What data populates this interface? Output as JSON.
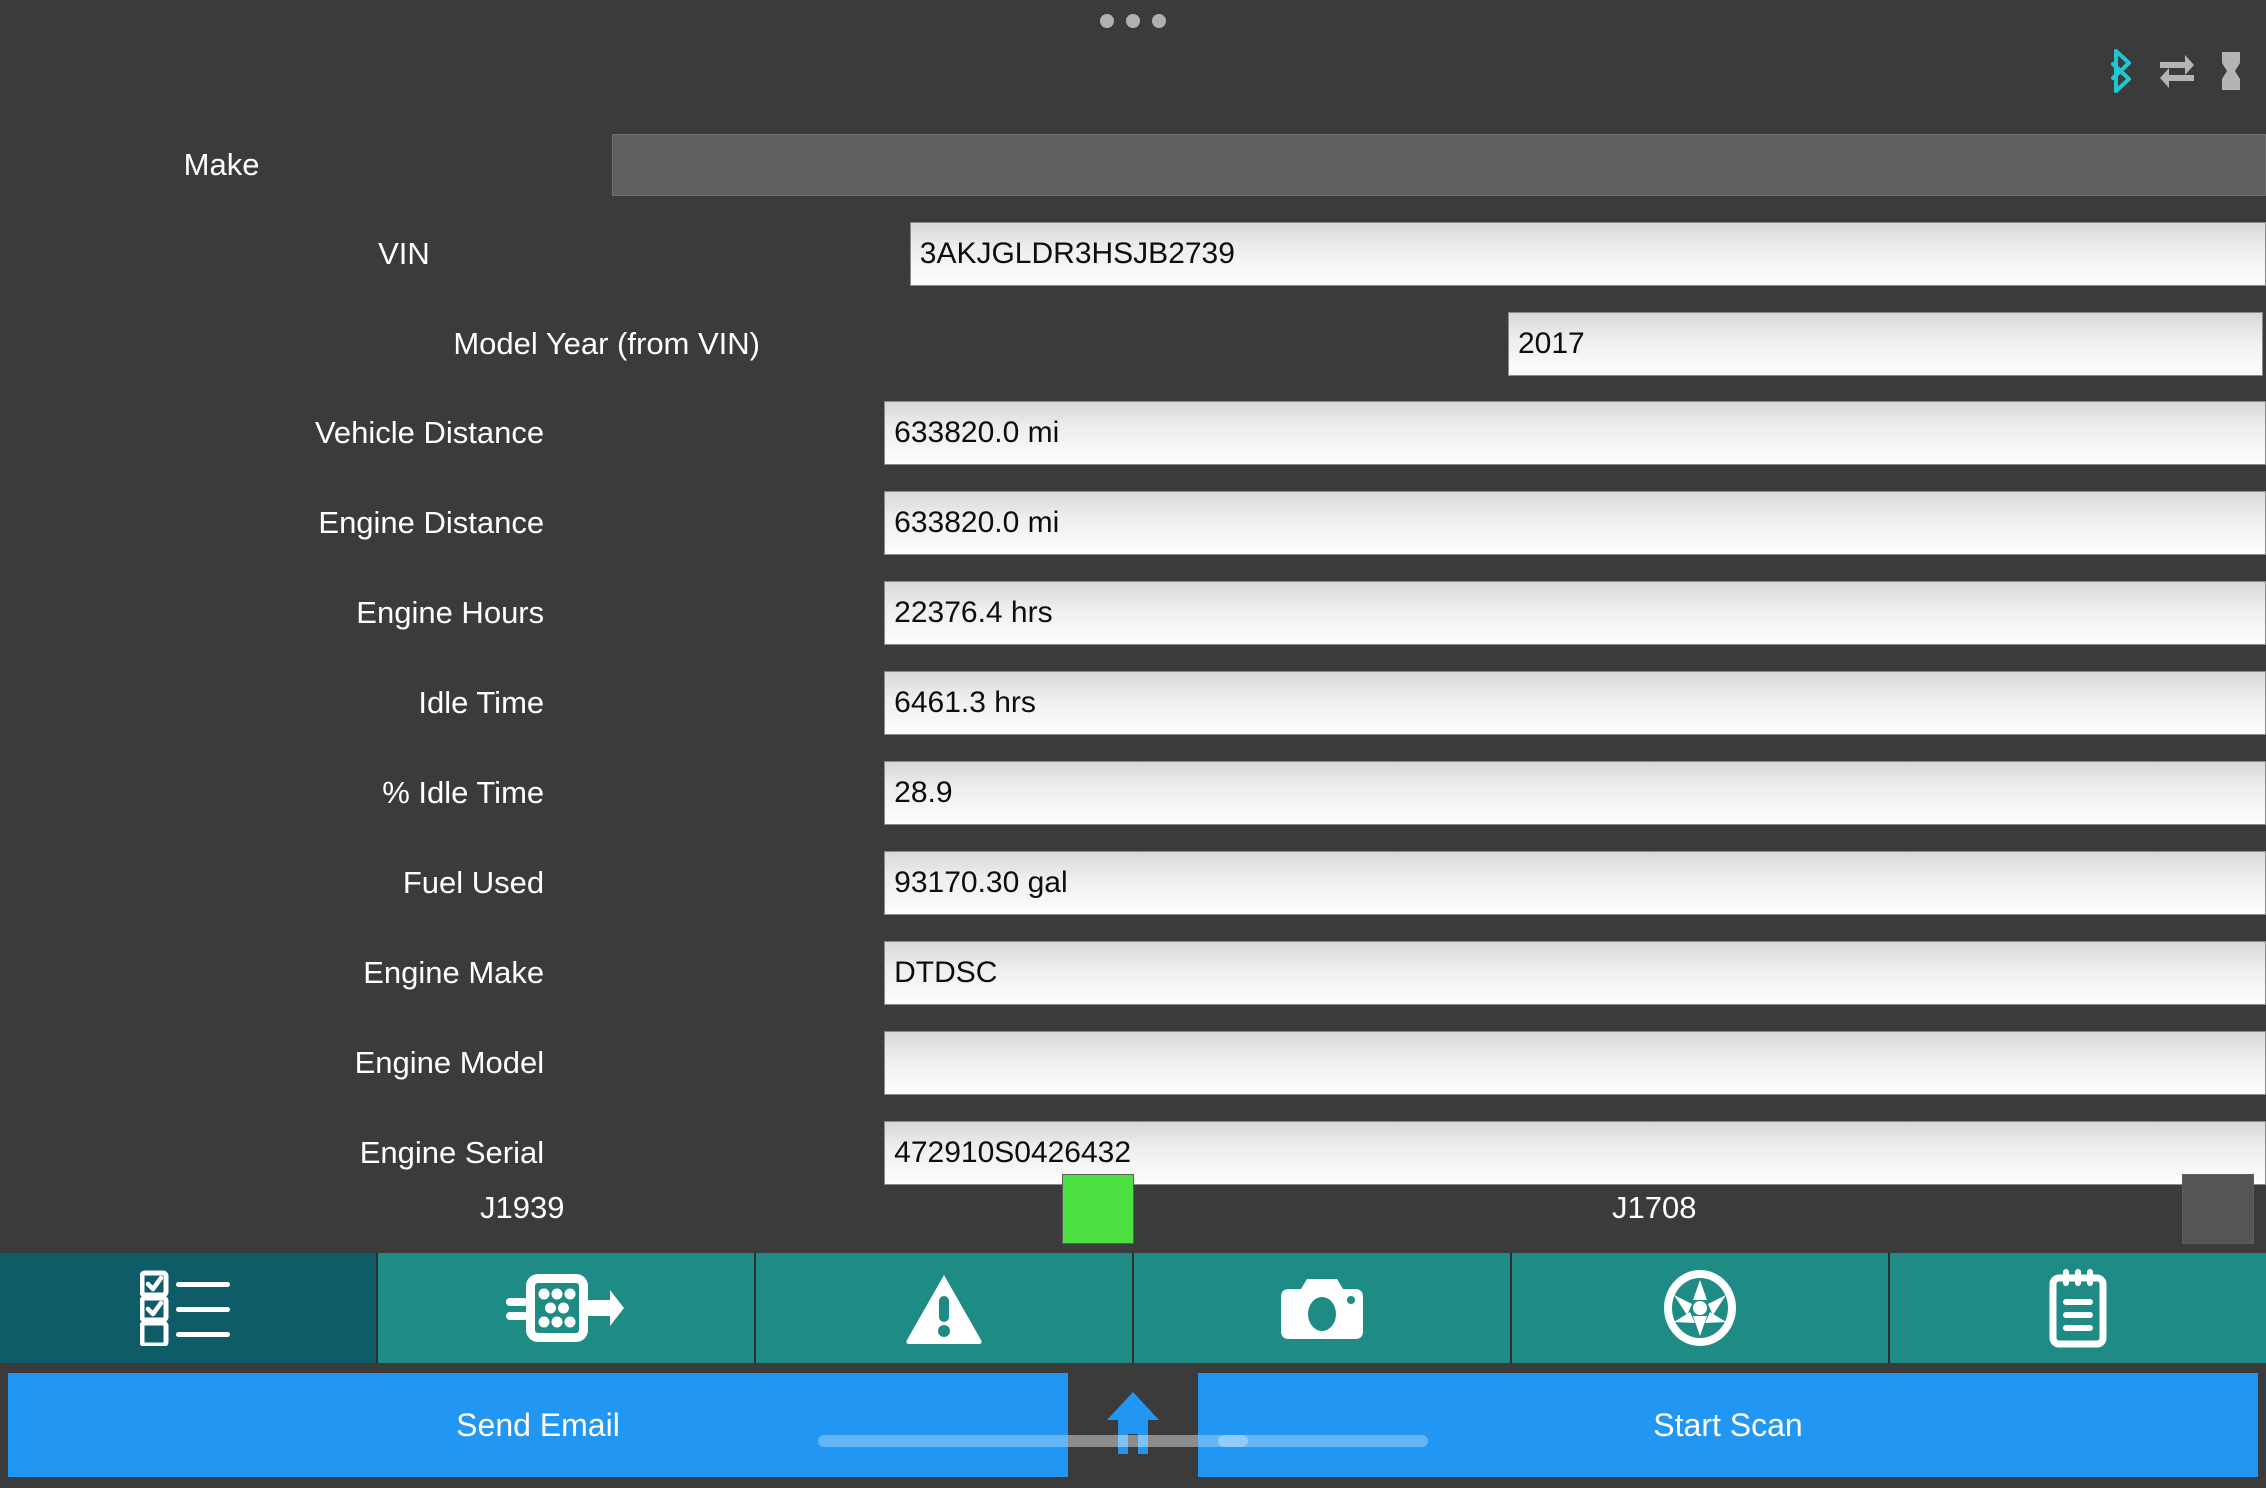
{
  "statusbar": {
    "overflow_dots": "•••",
    "icons": [
      {
        "name": "bluetooth-icon",
        "color": "#1ec8d0"
      },
      {
        "name": "data-transfer-icon",
        "color": "#b4b4b4"
      },
      {
        "name": "battery-icon",
        "color": "#b4b4b4"
      }
    ]
  },
  "form": {
    "fields": [
      {
        "label": "Make",
        "value": "",
        "state": "disabled"
      },
      {
        "label": "VIN",
        "value": "3AKJGLDR3HSJB2739",
        "state": "enabled"
      },
      {
        "label": "Model Year (from VIN)",
        "value": "2017",
        "state": "enabled"
      },
      {
        "label": "Vehicle Distance",
        "value": "633820.0 mi",
        "state": "enabled"
      },
      {
        "label": "Engine Distance",
        "value": "633820.0 mi",
        "state": "enabled"
      },
      {
        "label": "Engine Hours",
        "value": "22376.4 hrs",
        "state": "enabled"
      },
      {
        "label": "Idle Time",
        "value": "6461.3 hrs",
        "state": "enabled"
      },
      {
        "label": "% Idle Time",
        "value": "28.9",
        "state": "enabled"
      },
      {
        "label": "Fuel Used",
        "value": "93170.30 gal",
        "state": "enabled"
      },
      {
        "label": "Engine Make",
        "value": "DTDSC",
        "state": "enabled"
      },
      {
        "label": "Engine Model",
        "value": "",
        "state": "enabled"
      },
      {
        "label": "Engine Serial",
        "value": "472910S0426432",
        "state": "enabled"
      }
    ]
  },
  "protocols": [
    {
      "label": "J1939",
      "status": "active",
      "color": "#4CE040"
    },
    {
      "label": "J1708",
      "status": "inactive",
      "color": "#555555"
    }
  ],
  "tabs": [
    {
      "name": "tab-checklist",
      "icon": "checklist-icon",
      "active": true
    },
    {
      "name": "tab-connector",
      "icon": "connector-icon",
      "active": false
    },
    {
      "name": "tab-faults",
      "icon": "warning-icon",
      "active": false
    },
    {
      "name": "tab-camera",
      "icon": "camera-icon",
      "active": false
    },
    {
      "name": "tab-wheel",
      "icon": "wheel-icon",
      "active": false
    },
    {
      "name": "tab-notes",
      "icon": "notepad-icon",
      "active": false
    }
  ],
  "actions": {
    "send_email_label": "Send Email",
    "start_scan_label": "Start Scan",
    "home_icon": "home-icon"
  },
  "colors": {
    "background": "#3b3b3b",
    "tab_inactive": "#1e8c85",
    "tab_active": "#0d5c68",
    "button_blue": "#2196f3",
    "bluetooth": "#1ec8d0",
    "indicator_on": "#4CE040"
  }
}
